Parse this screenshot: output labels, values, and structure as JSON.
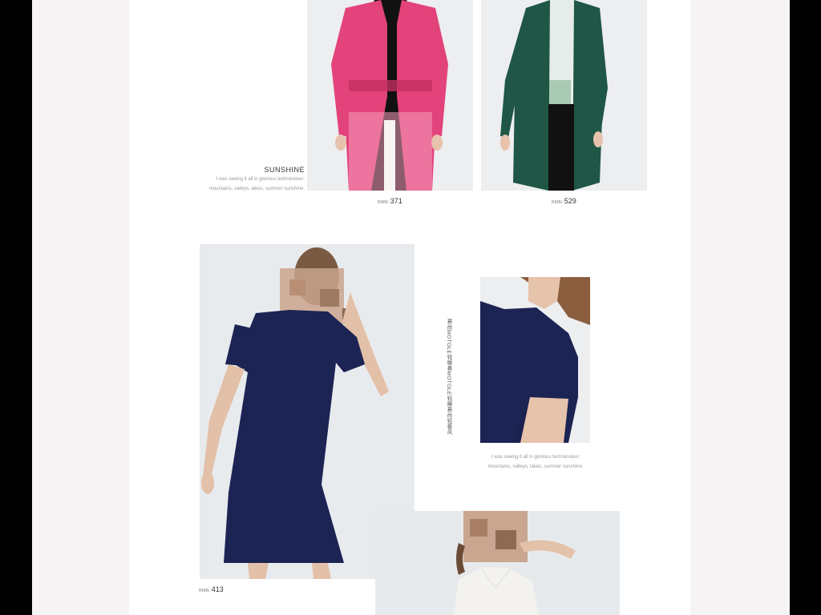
{
  "lookbook": {
    "feature_title": "SUNSHINE",
    "feature_text_1": "I was seeing it all in glorious technicolour:",
    "feature_text_2": "mountains, valleys, lakes, summer sunshine.",
    "vertical_text": "慕尚MOTOLE轻暖慕MOTOLE轻暖慕尚轻奢风",
    "detail_text_1": "I was seeing it all in glorious technicolour:",
    "detail_text_2": "mountains, valleys, lakes, summer sunshine."
  },
  "products": [
    {
      "name": "pink coat",
      "currency": "RMB/",
      "price": "371"
    },
    {
      "name": "green coat",
      "currency": "RMB/",
      "price": "529"
    },
    {
      "name": "navy dress",
      "currency": "RMB/",
      "price": "413"
    }
  ],
  "colors": {
    "pink_coat": "#e2437a",
    "green_coat": "#1f5646",
    "navy_dress": "#1c2454",
    "photo_bg": "#eceff2",
    "outer_bg": "#f5f3f4"
  }
}
